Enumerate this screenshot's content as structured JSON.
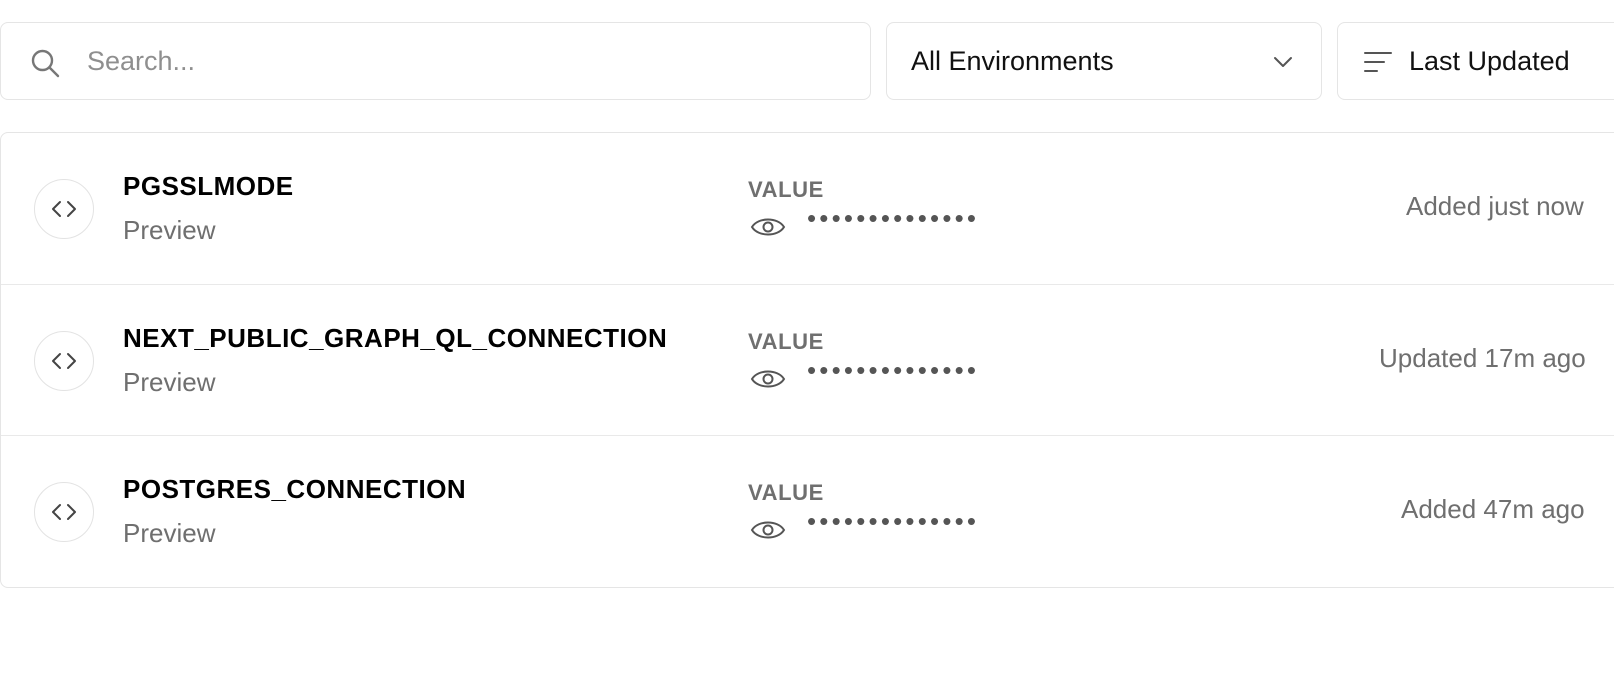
{
  "toolbar": {
    "search_placeholder": "Search...",
    "environment_filter": "All Environments",
    "sort_label": "Last Updated"
  },
  "variables": [
    {
      "name": "PGSSLMODE",
      "environment": "Preview",
      "value_label": "VALUE",
      "masked_value": "••••••••••••••",
      "status": "Added just now"
    },
    {
      "name": "NEXT_PUBLIC_GRAPH_QL_CONNECTION",
      "environment": "Preview",
      "value_label": "VALUE",
      "masked_value": "••••••••••••••",
      "status": "Updated 17m ago"
    },
    {
      "name": "POSTGRES_CONNECTION",
      "environment": "Preview",
      "value_label": "VALUE",
      "masked_value": "••••••••••••••",
      "status": "Added 47m ago"
    }
  ],
  "icons": {
    "search": "search-icon",
    "chevron": "chevron-down-icon",
    "sort": "sort-lines-icon",
    "code": "code-brackets-icon",
    "eye": "eye-icon"
  },
  "colors": {
    "border": "#e5e5e5",
    "muted_text": "#6f6f6f",
    "placeholder": "#8f8f8f"
  }
}
